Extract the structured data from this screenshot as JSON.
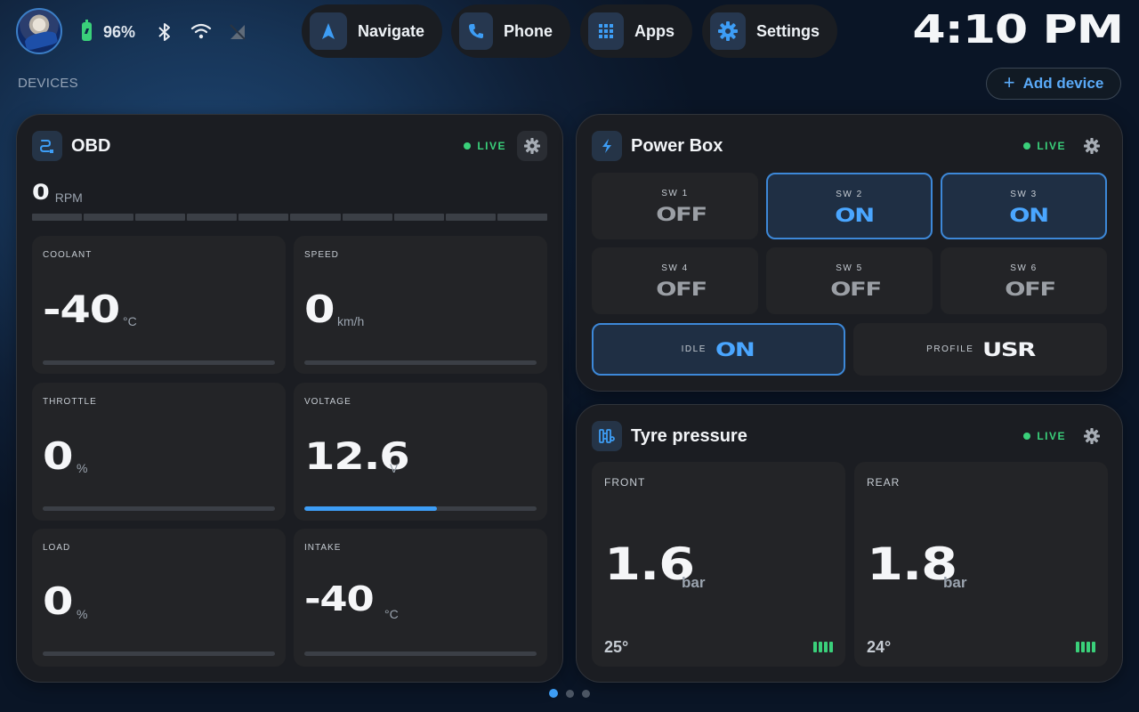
{
  "status": {
    "battery": "96%"
  },
  "nav": {
    "navigate": "Navigate",
    "phone": "Phone",
    "apps": "Apps",
    "settings": "Settings"
  },
  "clock": "4:10 PM",
  "devices_label": "DEVICES",
  "add_device": "Add device",
  "obd": {
    "title": "OBD",
    "live": "LIVE",
    "rpm": {
      "value": "0",
      "unit": "RPM"
    },
    "tiles": [
      {
        "label": "COOLANT",
        "value": "-40",
        "unit": "°C",
        "level": 0
      },
      {
        "label": "SPEED",
        "value": "0",
        "unit": "km/h",
        "level": 0
      },
      {
        "label": "THROTTLE",
        "value": "0",
        "unit": "%",
        "level": 0
      },
      {
        "label": "VOLTAGE",
        "value": "12.6",
        "unit": "V",
        "level": 0.57
      },
      {
        "label": "LOAD",
        "value": "0",
        "unit": "%",
        "level": 0
      },
      {
        "label": "INTAKE",
        "value": "-40",
        "unit": "°C",
        "level": 0
      }
    ]
  },
  "powerbox": {
    "title": "Power Box",
    "live": "LIVE",
    "switches": [
      {
        "label": "SW 1",
        "state": "OFF"
      },
      {
        "label": "SW 2",
        "state": "ON"
      },
      {
        "label": "SW 3",
        "state": "ON"
      },
      {
        "label": "SW 4",
        "state": "OFF"
      },
      {
        "label": "SW 5",
        "state": "OFF"
      },
      {
        "label": "SW 6",
        "state": "OFF"
      }
    ],
    "idle": {
      "label": "IDLE",
      "value": "ON"
    },
    "profile": {
      "label": "PROFILE",
      "value": "USR"
    }
  },
  "tyres": {
    "title": "Tyre pressure",
    "live": "LIVE",
    "front": {
      "label": "FRONT",
      "value": "1.6",
      "unit": "bar",
      "temp": "25°"
    },
    "rear": {
      "label": "REAR",
      "value": "1.8",
      "unit": "bar",
      "temp": "24°"
    }
  },
  "colors": {
    "accent": "#3d9df5",
    "live": "#3ad07a",
    "card": "#1b1d22",
    "tile": "#232427"
  }
}
